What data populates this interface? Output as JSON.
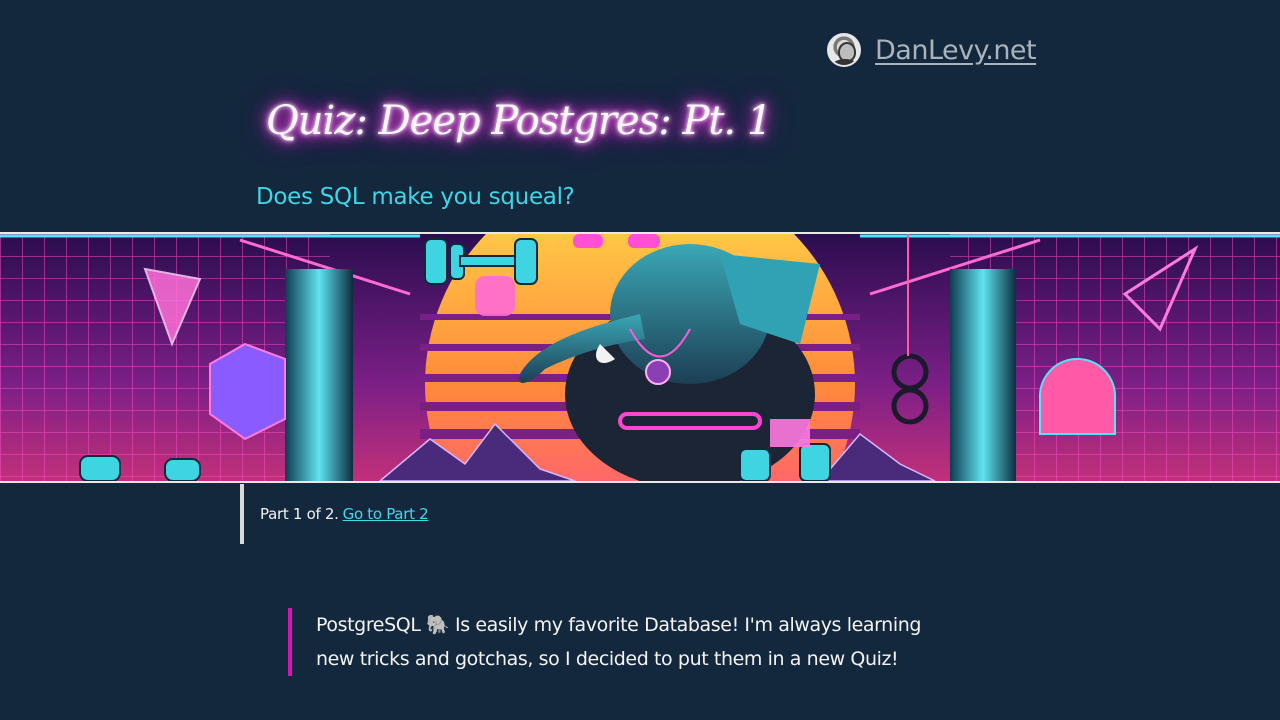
{
  "header": {
    "site_name": "DanLevy.net"
  },
  "post": {
    "title": "Quiz: Deep Postgres: Pt. 1",
    "subtitle": "Does SQL make you squeal?"
  },
  "series_note": {
    "text": "Part 1 of 2.",
    "link_label": "Go to Part 2"
  },
  "intro": {
    "text": "PostgreSQL 🐘 Is easily my favorite Database! I'm always learning new tricks and gotchas, so I decided to put them in a new Quiz!"
  },
  "colors": {
    "background": "#13273d",
    "subtitle": "#3fd6e6",
    "link": "#42d9ec",
    "accent_border": "#d814b9",
    "title_glow": "#ff2ee6"
  },
  "icons": {
    "avatar": "author-avatar",
    "hero": "synthwave-elephant-lifting-weights"
  }
}
